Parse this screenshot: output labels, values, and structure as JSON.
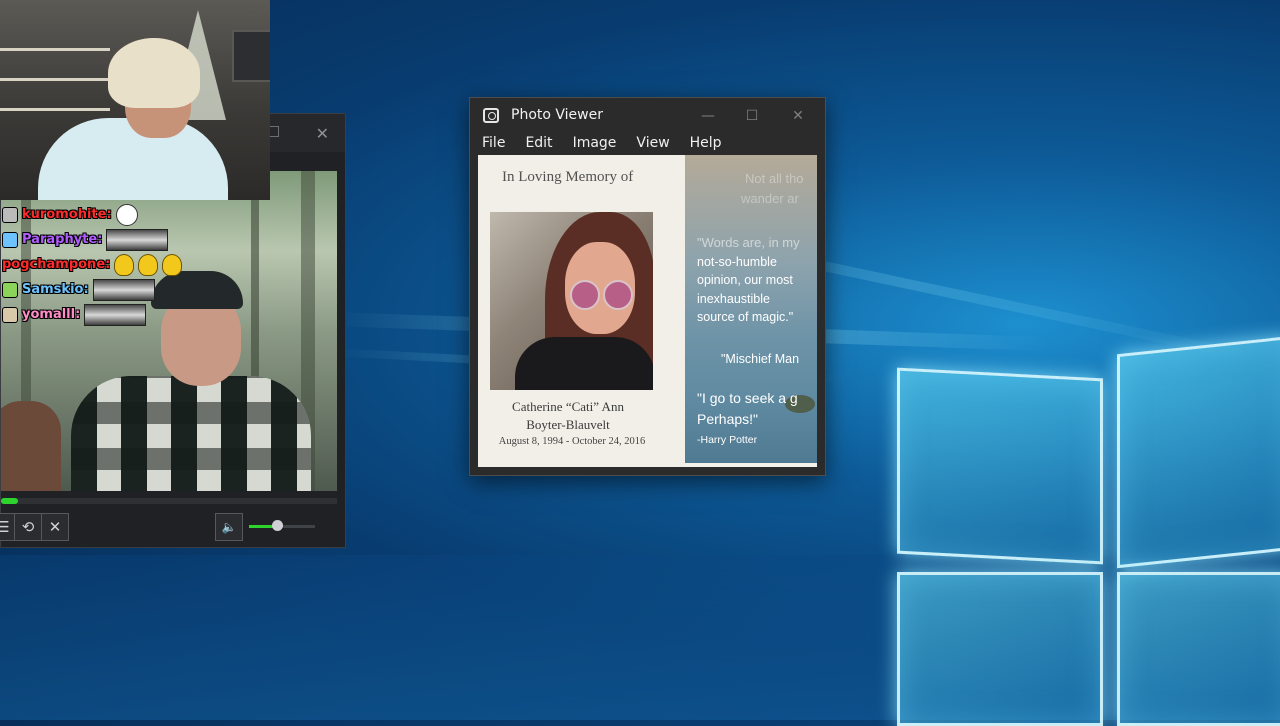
{
  "photo_viewer": {
    "title": "Photo Viewer",
    "menu": [
      "File",
      "Edit",
      "Image",
      "View",
      "Help"
    ],
    "window_controls": {
      "minimize": "—",
      "maximize": "☐",
      "close": "✕"
    },
    "image": {
      "header": "In Loving Memory of",
      "name_line1": "Catherine “Cati” Ann",
      "name_line2": "Boyter-Blauvelt",
      "dates": "August 8, 1994 - October 24, 2016",
      "quote_faint_1": "Not all tho",
      "quote_faint_2": "wander ar",
      "quote_faint_3": "\"Words are, in my",
      "quote_lines": [
        "not-so-humble",
        "opinion, our most",
        "inexhaustible",
        "source of magic.\""
      ],
      "quote_attr": "\"Mischief Man",
      "quote2_line1": "\"I go to seek a g",
      "quote2_line2": "Perhaps!\"",
      "quote2_attr": "-Harry Potter"
    }
  },
  "media_player": {
    "close_label": "✕",
    "progress": 0.05,
    "volume": 0.42,
    "controls": {
      "menu_icon": "☰",
      "loop_icon": "⟲",
      "close_icon": "✕",
      "volume_icon": "🔈"
    }
  },
  "chat": [
    {
      "user": "kuromohite:",
      "color": "#ff2a2a",
      "badge": "#bbbbbb",
      "emote": "face"
    },
    {
      "user": "Paraphyte:",
      "color": "#b05cff",
      "badge": "#6ec3ff",
      "emote": "wide"
    },
    {
      "user": "pogchampone:",
      "color": "#ff2a2a",
      "badge": "",
      "emote": "yellow3"
    },
    {
      "user": "Samskio:",
      "color": "#6ec3ff",
      "badge": "#8bd35b",
      "emote": "wide"
    },
    {
      "user": "yomalll:",
      "color": "#ff8bc8",
      "badge": "#d8c9a8",
      "emote": "wide"
    }
  ]
}
